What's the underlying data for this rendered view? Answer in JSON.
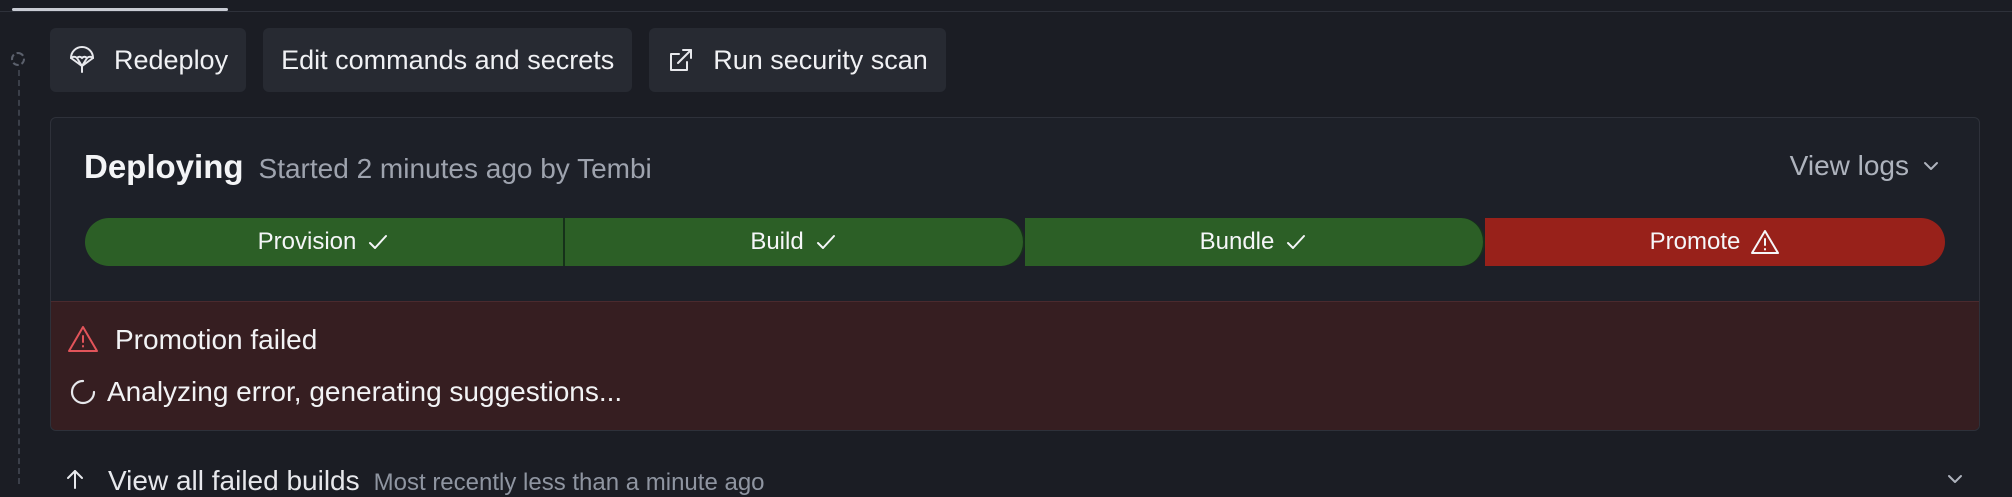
{
  "actions": {
    "redeploy": "Redeploy",
    "edit": "Edit commands and secrets",
    "scan": "Run security scan"
  },
  "deploy": {
    "title": "Deploying",
    "subtitle": "Started 2 minutes ago by Tembi",
    "view_logs": "View logs"
  },
  "pipeline": {
    "steps": [
      {
        "label": "Provision",
        "status": "success"
      },
      {
        "label": "Build",
        "status": "success"
      },
      {
        "label": "Bundle",
        "status": "success"
      },
      {
        "label": "Promote",
        "status": "failed"
      }
    ]
  },
  "error": {
    "title": "Promotion failed",
    "analyzing": "Analyzing error, generating suggestions..."
  },
  "failed_builds": {
    "title": "View all failed builds",
    "subtitle": "Most recently less than a minute ago"
  },
  "colors": {
    "success": "#2c5f26",
    "failed": "#98211a",
    "error_bg": "#361e21"
  },
  "icons": {
    "redeploy": "parachute-icon",
    "scan": "external-arrow-icon",
    "warning": "warning-triangle-icon",
    "spinner": "spinner-icon"
  }
}
